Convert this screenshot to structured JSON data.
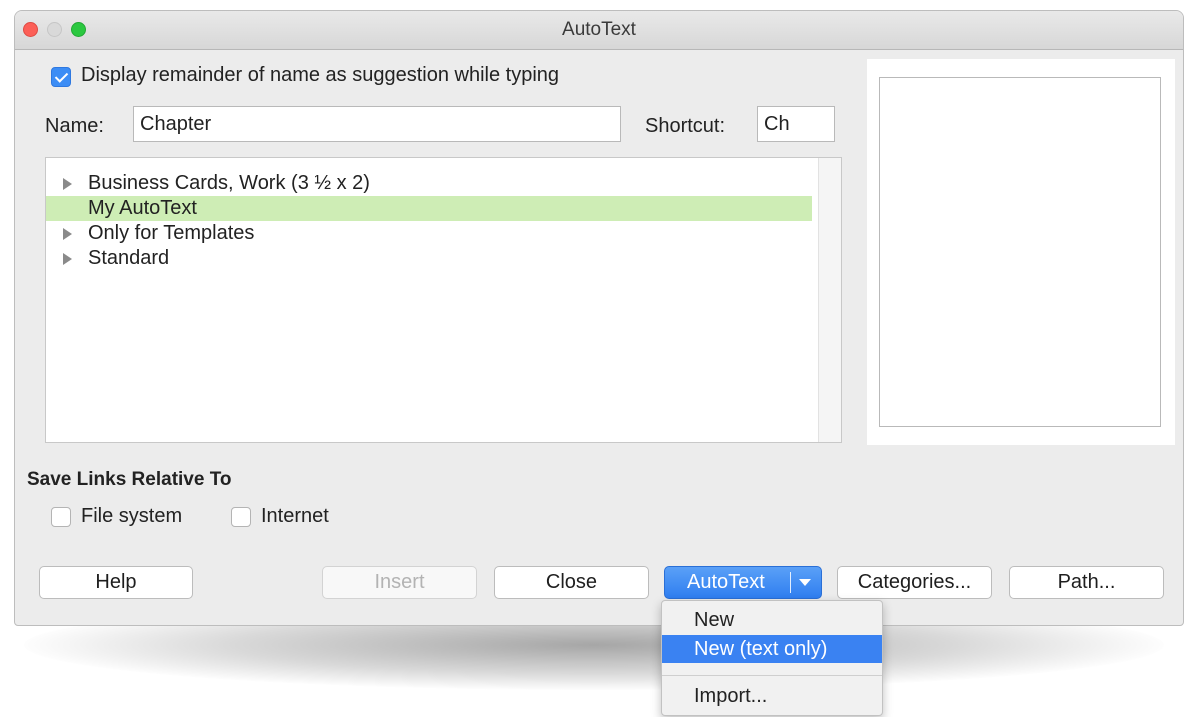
{
  "window": {
    "title": "AutoText"
  },
  "options": {
    "display_remainder_label": "Display remainder of name as suggestion while typing",
    "display_remainder_checked": true
  },
  "fields": {
    "name_label": "Name:",
    "name_value": "Chapter",
    "shortcut_label": "Shortcut:",
    "shortcut_value": "Ch"
  },
  "tree": {
    "items": [
      {
        "label": "Business Cards, Work (3 ½ x 2)",
        "expandable": true,
        "selected": false
      },
      {
        "label": "My AutoText",
        "expandable": false,
        "selected": true
      },
      {
        "label": "Only for Templates",
        "expandable": true,
        "selected": false
      },
      {
        "label": "Standard",
        "expandable": true,
        "selected": false
      }
    ]
  },
  "save_links": {
    "heading": "Save Links Relative To",
    "file_system_label": "File system",
    "file_system_checked": false,
    "internet_label": "Internet",
    "internet_checked": false
  },
  "buttons": {
    "help": "Help",
    "insert": "Insert",
    "close": "Close",
    "autotext": "AutoText",
    "categories": "Categories...",
    "path": "Path..."
  },
  "autotext_menu": {
    "items": [
      "New",
      "New (text only)",
      "Import..."
    ],
    "highlighted": "New (text only)"
  },
  "colors": {
    "accent": "#3a82f2",
    "selection": "#ceedb5",
    "close_light": "#fc5f57",
    "zoom_light": "#2bc840"
  }
}
